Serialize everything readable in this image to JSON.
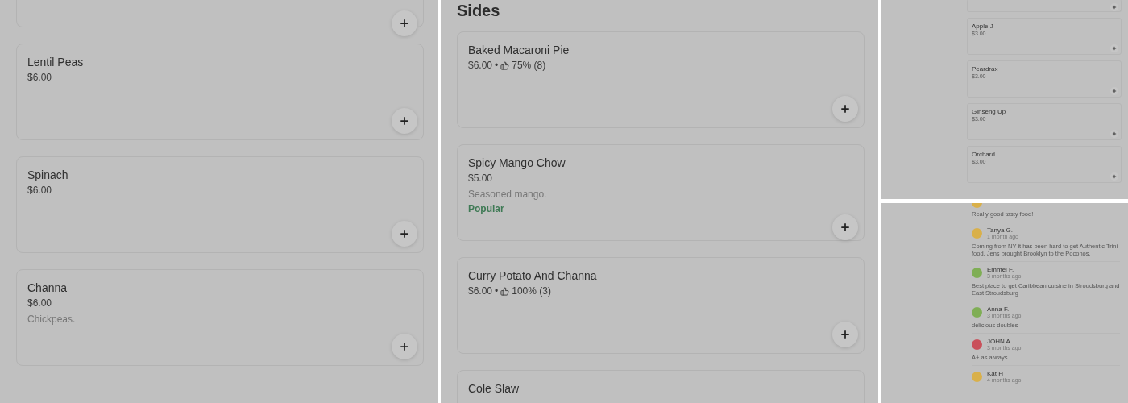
{
  "panels": [
    {
      "kind": "menu",
      "items": [
        {
          "kind": "stub"
        },
        {
          "kind": "item",
          "name": "Lentil Peas",
          "price": "$6.00"
        },
        {
          "kind": "item",
          "name": "Spinach",
          "price": "$6.00"
        },
        {
          "kind": "item",
          "name": "Channa",
          "price": "$6.00",
          "description": "Chickpeas."
        }
      ]
    },
    {
      "kind": "menu",
      "heading": "Sides",
      "items": [
        {
          "kind": "item",
          "name": "Baked Macaroni Pie",
          "price": "$6.00",
          "separator": "•",
          "rating": "75% (8)"
        },
        {
          "kind": "item",
          "name": "Spicy Mango Chow",
          "price": "$5.00",
          "description": "Seasoned mango.",
          "tag": "Popular"
        },
        {
          "kind": "item",
          "name": "Curry Potato And Channa",
          "price": "$6.00",
          "separator": "•",
          "rating": "100% (3)"
        },
        {
          "kind": "cut",
          "name": "Cole Slaw"
        }
      ]
    }
  ],
  "mini_menu": {
    "items": [
      {
        "kind": "stub"
      },
      {
        "kind": "item",
        "name": "Apple J",
        "price": "$3.00"
      },
      {
        "kind": "item",
        "name": "Peardrax",
        "price": "$3.00"
      },
      {
        "kind": "item",
        "name": "Ginseng Up",
        "price": "$3.00"
      },
      {
        "kind": "item",
        "name": "Orchard",
        "price": "$3.00"
      }
    ]
  },
  "reviews": [
    {
      "kind": "cut",
      "color": "#d9b04a",
      "text": "Really good tasty food!"
    },
    {
      "kind": "full",
      "color": "#d9b04a",
      "name": "Tanya G.",
      "time": "1 month ago",
      "text": "Coming from NY it has been hard to get Authentic Trini food. Jens brought Brooklyn to the Poconos."
    },
    {
      "kind": "full",
      "color": "#7fae55",
      "name": "Emmel F.",
      "time": "3 months ago",
      "text": "Best place to get Caribbean cuisine in Stroudsburg and East Stroudsburg"
    },
    {
      "kind": "full",
      "color": "#7fae55",
      "name": "Anna F.",
      "time": "3 months ago",
      "text": "delicious doubles"
    },
    {
      "kind": "full",
      "color": "#c9505a",
      "name": "JOHN A",
      "time": "3 months ago",
      "text": "A+ as always"
    },
    {
      "kind": "full",
      "color": "#d9b04a",
      "name": "Kat H",
      "time": "4 months ago"
    }
  ]
}
